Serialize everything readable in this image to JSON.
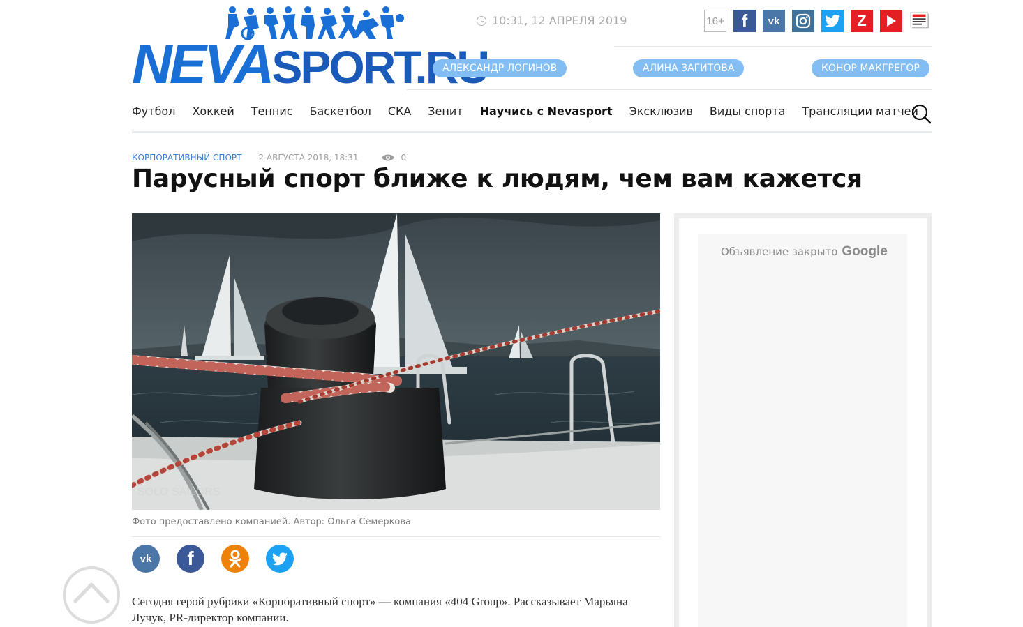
{
  "header": {
    "logo_neva": "NEVA",
    "logo_sport": "SPORT.RU",
    "datetime": "10:31,  12 АПРЕЛЯ 2019",
    "age_rating": "16+",
    "social_icons": [
      "facebook-icon",
      "vk-icon",
      "instagram-icon",
      "twitter-icon",
      "zen-icon",
      "youtube-icon",
      "news-icon"
    ],
    "tags": [
      "АЛЕКСАНДР ЛОГИНОВ",
      "АЛИНА ЗАГИТОВА",
      "КОНОР МАКГРЕГОР"
    ]
  },
  "nav": {
    "items": [
      "Футбол",
      "Хоккей",
      "Теннис",
      "Баскетбол",
      "СКА",
      "Зенит",
      "Научись с Nevasport",
      "Эксклюзив",
      "Виды спорта",
      "Трансляции матчей"
    ],
    "search_icon": "search-icon"
  },
  "article": {
    "category": "КОРПОРАТИВНЫЙ СПОРТ",
    "date": "2 АВГУСТА 2018, 18:31",
    "views": "0",
    "title": "Парусный спорт ближе к людям, чем вам кажется",
    "photo_watermark": "SOLO SAILORS",
    "photo_caption": "Фото предоставлено компанией. Автор: Ольга Семеркова",
    "share_icons": [
      "vk-share-icon",
      "facebook-share-icon",
      "odnoklassniki-share-icon",
      "twitter-share-icon"
    ],
    "lead": "Сегодня герой рубрики «Корпоративный спорт» — компания  «404 Group». Рассказывает Марьяна Лучук, PR-директор компании."
  },
  "ad": {
    "closed_text": "Объявление закрыто",
    "google": "Google"
  },
  "colors": {
    "brand_blue": "#1a6fd6",
    "tag_blue": "#82bdf4",
    "category_blue": "#3b7fd1"
  }
}
